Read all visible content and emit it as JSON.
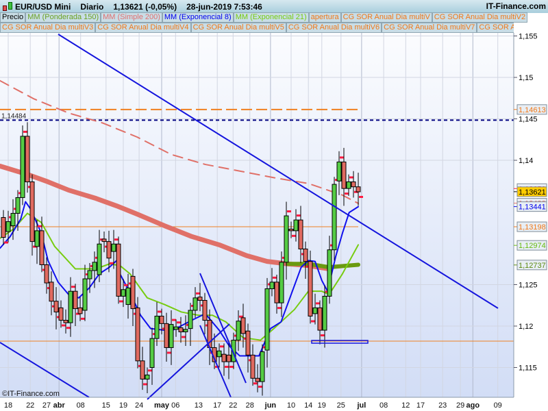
{
  "header": {
    "symbol": "EUR/USD Mini",
    "period": "Diario",
    "last": "1,13621 (-0,05%)",
    "datetime": "28-jun-2019 7:53:46",
    "brand": "IT-Finance.com"
  },
  "legend_row1": [
    {
      "label": "Precio",
      "color": "#000000"
    },
    {
      "label": "MM (Ponderada 150)",
      "color": "#6aa121"
    },
    {
      "label": "MM (Simple 200)",
      "color": "#e07070"
    },
    {
      "label": "MM (Exponencial 8)",
      "color": "#0000ee"
    },
    {
      "label": "MM (Exponencial 21)",
      "color": "#77cc11"
    },
    {
      "label": "apertura",
      "color": "#f07818"
    },
    {
      "label": "CG SOR Anual Dia multiV",
      "color": "#f07818"
    },
    {
      "label": "CG SOR Anual Dia multiV2",
      "color": "#f07818"
    }
  ],
  "legend_row2": [
    {
      "label": "CG SOR Anual Dia multiV3",
      "color": "#f07818"
    },
    {
      "label": "CG SOR Anual Dia multiV4",
      "color": "#f07818"
    },
    {
      "label": "CG SOR Anual Dia multiV5",
      "color": "#f07818"
    },
    {
      "label": "CG SOR Anual Dia multiV6",
      "color": "#f07818"
    },
    {
      "label": "CG SOR Anual Dia multiV7",
      "color": "#f07818"
    },
    {
      "label": "CG SOR Anual Dia",
      "color": "#f07818"
    }
  ],
  "watermark": "©IT-Finance.com",
  "chart_data": {
    "type": "candlestick",
    "title": "EUR/USD Mini Diario",
    "ylim": [
      1.1125,
      1.1562
    ],
    "y_ticks": [
      {
        "v": 1.155,
        "t": "1,155"
      },
      {
        "v": 1.15,
        "t": "1,15"
      },
      {
        "v": 1.145,
        "t": "1,145"
      },
      {
        "v": 1.14,
        "t": "1,14"
      },
      {
        "v": 1.125,
        "t": "1,125"
      },
      {
        "v": 1.12,
        "t": "1,12"
      },
      {
        "v": 1.115,
        "t": "1,115"
      }
    ],
    "x_ticks": [
      {
        "i": 1,
        "t": "18",
        "b": false
      },
      {
        "i": 5.6,
        "t": "22",
        "b": false
      },
      {
        "i": 9,
        "t": "27",
        "b": false
      },
      {
        "i": 11.6,
        "t": "abr",
        "b": true
      },
      {
        "i": 16.1,
        "t": "08",
        "b": false
      },
      {
        "i": 21.4,
        "t": "15",
        "b": false
      },
      {
        "i": 25,
        "t": "19",
        "b": false
      },
      {
        "i": 28.3,
        "t": "24",
        "b": false
      },
      {
        "i": 33,
        "t": "may",
        "b": true
      },
      {
        "i": 35.9,
        "t": "06",
        "b": false
      },
      {
        "i": 40.7,
        "t": "13",
        "b": false
      },
      {
        "i": 44.6,
        "t": "17",
        "b": false
      },
      {
        "i": 47.9,
        "t": "22",
        "b": false
      },
      {
        "i": 51.4,
        "t": "28",
        "b": false
      },
      {
        "i": 55.7,
        "t": "jun",
        "b": true
      },
      {
        "i": 60,
        "t": "10",
        "b": false
      },
      {
        "i": 63.6,
        "t": "14",
        "b": false
      },
      {
        "i": 66.4,
        "t": "19",
        "b": false
      },
      {
        "i": 70.4,
        "t": "25",
        "b": false
      },
      {
        "i": 74.7,
        "t": "jul",
        "b": true
      },
      {
        "i": 79.3,
        "t": "08",
        "b": false
      },
      {
        "i": 83.9,
        "t": "12",
        "b": false
      },
      {
        "i": 87,
        "t": "17",
        "b": false
      },
      {
        "i": 91.6,
        "t": "23",
        "b": false
      },
      {
        "i": 95.3,
        "t": "29",
        "b": false
      },
      {
        "i": 97.9,
        "t": "ago",
        "b": true
      },
      {
        "i": 103.1,
        "t": "09",
        "b": false
      }
    ],
    "candles": [
      [
        1.1331,
        1.1307
      ],
      [
        1.1314,
        1.1326
      ],
      [
        1.1321,
        1.1336
      ],
      [
        1.1336,
        1.1355
      ],
      [
        1.1355,
        1.1429
      ],
      [
        1.1429,
        1.1374
      ],
      [
        1.1374,
        1.1302
      ],
      [
        1.1296,
        1.1315
      ],
      [
        1.1315,
        1.1274
      ],
      [
        1.1274,
        1.1252
      ],
      [
        1.1253,
        1.123
      ],
      [
        1.123,
        1.1217
      ],
      [
        1.1222,
        1.1207
      ],
      [
        1.1207,
        1.1204
      ],
      [
        1.1204,
        1.1242
      ],
      [
        1.1242,
        1.1221
      ],
      [
        1.1222,
        1.1215
      ],
      [
        1.1219,
        1.1257
      ],
      [
        1.1257,
        1.1267
      ],
      [
        1.1267,
        1.1277
      ],
      [
        1.1262,
        1.1299
      ],
      [
        1.1305,
        1.1302
      ],
      [
        1.1302,
        1.1282
      ],
      [
        1.129,
        1.1299
      ],
      [
        1.1299,
        1.1236
      ],
      [
        1.1236,
        1.1244
      ],
      [
        1.1226,
        1.1246
      ],
      [
        1.126,
        1.1221
      ],
      [
        1.1222,
        1.1158
      ],
      [
        1.1158,
        1.1136
      ],
      [
        1.1136,
        1.1141
      ],
      [
        1.115,
        1.1185
      ],
      [
        1.1185,
        1.1212
      ],
      [
        1.1212,
        1.1203
      ],
      [
        1.1203,
        1.1174
      ],
      [
        1.1174,
        1.1202
      ],
      [
        1.1196,
        1.1199
      ],
      [
        1.1198,
        1.1193
      ],
      [
        1.1193,
        1.1196
      ],
      [
        1.1197,
        1.1219
      ],
      [
        1.1219,
        1.1234
      ],
      [
        1.1235,
        1.1231
      ],
      [
        1.1231,
        1.1207
      ],
      [
        1.1207,
        1.1174
      ],
      [
        1.1174,
        1.1157
      ],
      [
        1.1163,
        1.117
      ],
      [
        1.1166,
        1.1157
      ],
      [
        1.1165,
        1.1157
      ],
      [
        1.1157,
        1.1183
      ],
      [
        1.1183,
        1.1206
      ],
      [
        1.121,
        1.1191
      ],
      [
        1.1194,
        1.1165
      ],
      [
        1.1165,
        1.1137
      ],
      [
        1.1137,
        1.1133
      ],
      [
        1.1133,
        1.1169
      ],
      [
        1.1171,
        1.1245
      ],
      [
        1.1245,
        1.1253
      ],
      [
        1.1253,
        1.1228
      ],
      [
        1.1228,
        1.1277
      ],
      [
        1.1277,
        1.1333
      ],
      [
        1.1317,
        1.1315
      ],
      [
        1.1315,
        1.1328
      ],
      [
        1.1328,
        1.1293
      ],
      [
        1.1293,
        1.1278
      ],
      [
        1.1278,
        1.1212
      ],
      [
        1.1215,
        1.1222
      ],
      [
        1.1222,
        1.1195
      ],
      [
        1.1195,
        1.1236
      ],
      [
        1.1236,
        1.1292
      ],
      [
        1.1292,
        1.1371
      ],
      [
        1.1375,
        1.1398
      ],
      [
        1.1398,
        1.1366
      ],
      [
        1.1366,
        1.1374
      ],
      [
        1.1374,
        1.1368
      ],
      [
        1.1368,
        1.1362
      ]
    ],
    "series": [
      {
        "name": "MM (Simple 200)",
        "color": "#e07068",
        "style": "thick",
        "points": [
          [
            -0.7,
            1.1393
          ],
          [
            5,
            1.1383
          ],
          [
            9.3,
            1.1374
          ],
          [
            13.6,
            1.1364
          ],
          [
            19.3,
            1.1354
          ],
          [
            23.6,
            1.1345
          ],
          [
            27.9,
            1.1335
          ],
          [
            33.6,
            1.1321
          ],
          [
            39.3,
            1.1308
          ],
          [
            45,
            1.1298
          ],
          [
            50.7,
            1.1285
          ],
          [
            55,
            1.1278
          ],
          [
            59.3,
            1.1275
          ],
          [
            63.6,
            1.1273
          ],
          [
            67.9,
            1.1269
          ]
        ]
      },
      {
        "name": "MM (Ponderada 150)",
        "color": "#6a9a10",
        "style": "thick",
        "points": [
          [
            59.3,
            1.1275
          ],
          [
            63.6,
            1.1275
          ],
          [
            67.9,
            1.1271
          ],
          [
            74,
            1.1274
          ]
        ]
      },
      {
        "name": "Dashed average",
        "color": "#e07068",
        "style": "dashed",
        "points": [
          [
            -0.7,
            1.1496
          ],
          [
            6.4,
            1.1474
          ],
          [
            13.6,
            1.1457
          ],
          [
            20.7,
            1.1445
          ],
          [
            27.9,
            1.1428
          ],
          [
            35,
            1.1407
          ],
          [
            42.1,
            1.1395
          ],
          [
            49.3,
            1.1387
          ],
          [
            56.4,
            1.1379
          ],
          [
            63.6,
            1.1372
          ],
          [
            70.7,
            1.1358
          ],
          [
            74,
            1.1348
          ]
        ]
      },
      {
        "name": "MM (Exponencial 21)",
        "color": "#77cc11",
        "style": "normal",
        "points": [
          [
            -0.7,
            1.1306
          ],
          [
            2.1,
            1.1317
          ],
          [
            5,
            1.1336
          ],
          [
            7.9,
            1.1325
          ],
          [
            10.7,
            1.1296
          ],
          [
            15,
            1.1269
          ],
          [
            19.3,
            1.1269
          ],
          [
            22.1,
            1.1275
          ],
          [
            24.3,
            1.1273
          ],
          [
            26.4,
            1.1263
          ],
          [
            30,
            1.1234
          ],
          [
            33.6,
            1.1226
          ],
          [
            37.1,
            1.1217
          ],
          [
            40.7,
            1.1213
          ],
          [
            43.6,
            1.1213
          ],
          [
            46.4,
            1.1205
          ],
          [
            50,
            1.1186
          ],
          [
            53.6,
            1.1183
          ],
          [
            56.4,
            1.1197
          ],
          [
            60.7,
            1.122
          ],
          [
            63.6,
            1.1242
          ],
          [
            66.4,
            1.1242
          ],
          [
            67.9,
            1.1238
          ],
          [
            70.7,
            1.1263
          ],
          [
            74,
            1.1298
          ]
        ]
      },
      {
        "name": "MM (Exponencial 8)",
        "color": "#1010ee",
        "style": "normal",
        "points": [
          [
            -0.7,
            1.1294
          ],
          [
            1.4,
            1.1308
          ],
          [
            3.6,
            1.1329
          ],
          [
            4.6,
            1.135
          ],
          [
            5.7,
            1.1341
          ],
          [
            7.9,
            1.1312
          ],
          [
            9.3,
            1.1279
          ],
          [
            11.4,
            1.1253
          ],
          [
            13.6,
            1.1238
          ],
          [
            15.7,
            1.1234
          ],
          [
            17.9,
            1.1246
          ],
          [
            20,
            1.1263
          ],
          [
            22.1,
            1.1271
          ],
          [
            23.6,
            1.1279
          ],
          [
            24.3,
            1.1263
          ],
          [
            26.4,
            1.124
          ],
          [
            28.6,
            1.1213
          ],
          [
            30.7,
            1.1197
          ],
          [
            35,
            1.1194
          ],
          [
            39.3,
            1.1207
          ],
          [
            42.1,
            1.1215
          ],
          [
            45,
            1.1195
          ],
          [
            47.1,
            1.1176
          ],
          [
            49.3,
            1.1164
          ],
          [
            53.3,
            1.1164
          ],
          [
            55.7,
            1.1197
          ],
          [
            57.9,
            1.1205
          ],
          [
            60,
            1.1238
          ],
          [
            62.1,
            1.1271
          ],
          [
            63.6,
            1.1279
          ],
          [
            65,
            1.1278
          ],
          [
            66.4,
            1.1255
          ],
          [
            67.6,
            1.1242
          ],
          [
            69.3,
            1.1284
          ],
          [
            70.7,
            1.1312
          ],
          [
            72.1,
            1.1337
          ],
          [
            74,
            1.1344
          ]
        ]
      }
    ],
    "hlines": [
      {
        "v": 1.14613,
        "color": "#f08020",
        "style": "longdash",
        "to": 74
      },
      {
        "v": 1.14484,
        "color": "#000080",
        "style": "dash",
        "label": "1,14484"
      },
      {
        "v": 1.13198,
        "color": "#f08020",
        "style": "thin",
        "to": 74
      },
      {
        "v": 1.11818,
        "color": "#f08020",
        "style": "thin"
      }
    ],
    "price_labels": [
      {
        "v": 1.14613,
        "t": "1,14613",
        "color": "#f07818",
        "bg": "#e8eef4"
      },
      {
        "v": 1.13659,
        "t": "1,13659",
        "color": "#ff2040",
        "bg": "#e8eef4"
      },
      {
        "v": 1.13621,
        "t": "1,13621",
        "color": "#000000",
        "bg": "#ffcc00"
      },
      {
        "v": 1.13483,
        "t": "1,13483",
        "color": "#e07068",
        "bg": "#e8eef4"
      },
      {
        "v": 1.13441,
        "t": "1,13441",
        "color": "#0000ee",
        "bg": "#e8eef4"
      },
      {
        "v": 1.13198,
        "t": "1,13198",
        "color": "#f07818",
        "bg": "#e8eef4"
      },
      {
        "v": 1.12974,
        "t": "1,12974",
        "color": "#66bb11",
        "bg": "#e8eef4"
      },
      {
        "v": 1.12737,
        "t": "1,12737",
        "color": "#5a8a10",
        "bg": "#e8eef4"
      }
    ],
    "up_color": "#55cc44",
    "down_color": "#e06a60"
  }
}
